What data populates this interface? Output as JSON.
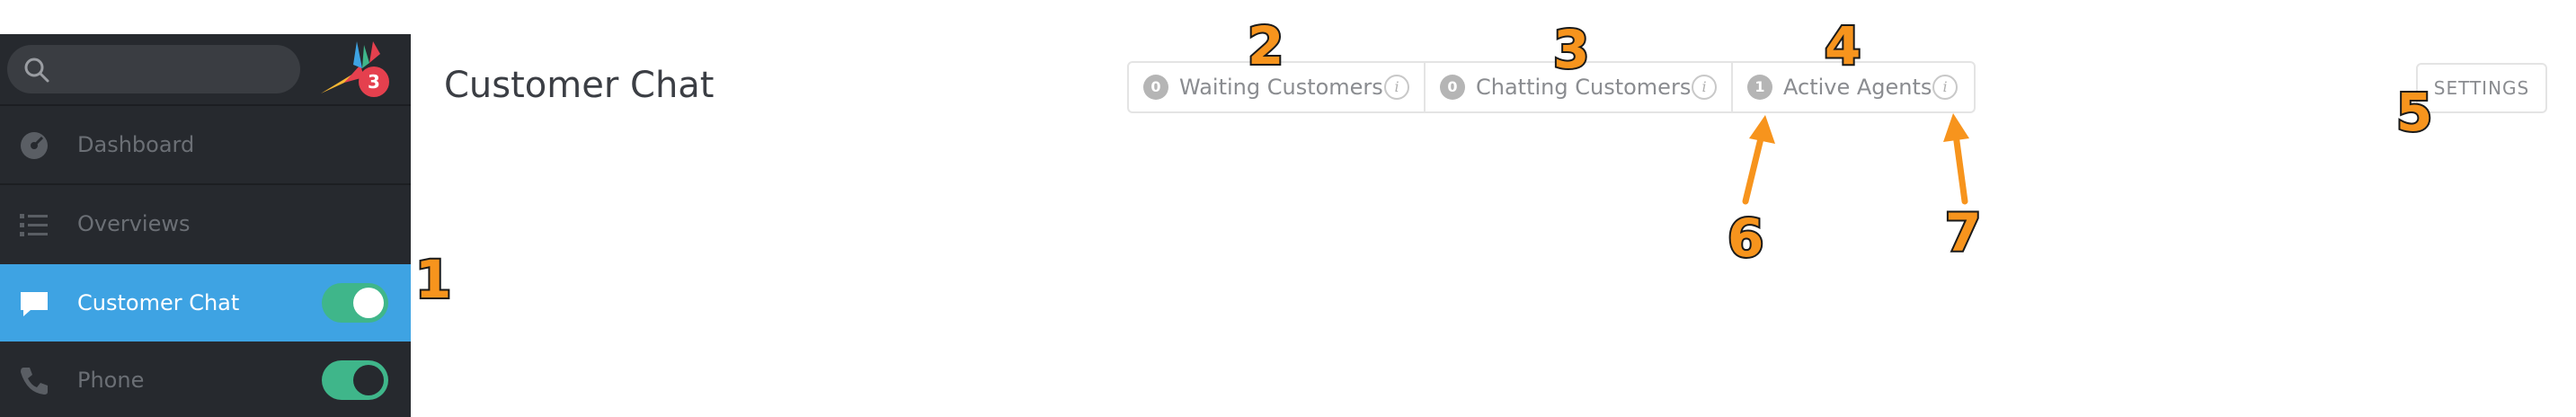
{
  "sidebar": {
    "search": {
      "placeholder": ""
    },
    "logo": {
      "notification_count": "3"
    },
    "items": [
      {
        "label": "Dashboard",
        "icon": "dashboard-icon"
      },
      {
        "label": "Overviews",
        "icon": "list-icon"
      },
      {
        "label": "Customer Chat",
        "icon": "chat-bubble-icon",
        "active": true,
        "toggle": "on"
      },
      {
        "label": "Phone",
        "icon": "phone-icon",
        "toggle": "on"
      }
    ]
  },
  "header": {
    "title": "Customer Chat",
    "stats": [
      {
        "count": "0",
        "label": "Waiting Customers"
      },
      {
        "count": "0",
        "label": "Chatting Customers"
      },
      {
        "count": "1",
        "label": "Active Agents"
      }
    ],
    "settings_label": "SETTINGS"
  },
  "annotations": {
    "n1": "1",
    "n2": "2",
    "n3": "3",
    "n4": "4",
    "n5": "5",
    "n6": "6",
    "n7": "7"
  },
  "colors": {
    "sidebar_bg": "#26292e",
    "active_item": "#3ea3e3",
    "toggle_on": "#3fb68a",
    "badge_red": "#e5404e",
    "callout_orange": "#f7941d"
  }
}
